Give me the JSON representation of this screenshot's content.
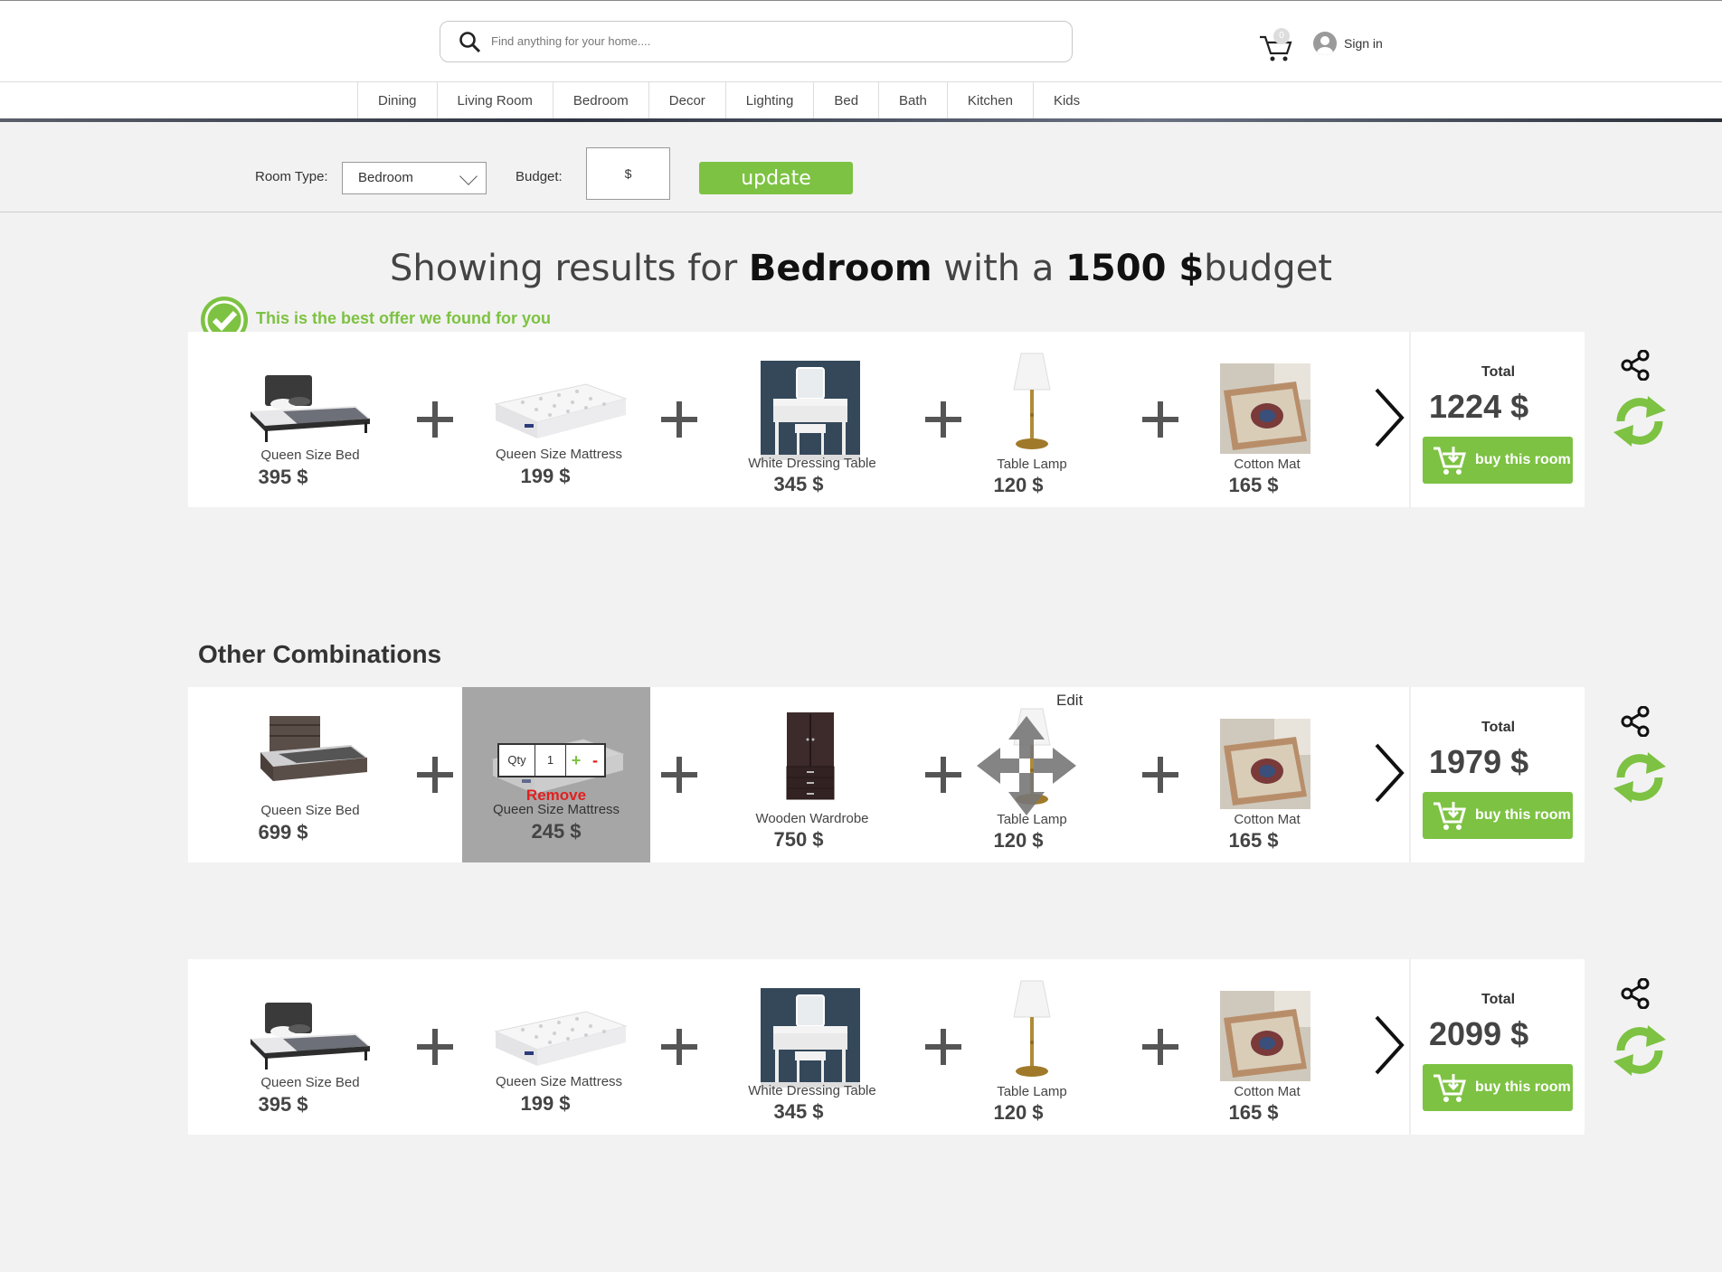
{
  "header": {
    "search_placeholder": "Find anything for your home....",
    "cart_count": "0",
    "signin_label": "Sign in"
  },
  "nav": {
    "items": [
      "Dining",
      "Living Room",
      "Bedroom",
      "Decor",
      "Lighting",
      "Bed",
      "Bath",
      "Kitchen",
      "Kids"
    ]
  },
  "filter": {
    "room_type_label": "Room Type:",
    "room_type_value": "Bedroom",
    "budget_label": "Budget:",
    "budget_value": "$",
    "update_label": "update"
  },
  "headline": {
    "prefix": "Showing results for ",
    "room": "Bedroom",
    "middle": " with a ",
    "budget": "1500 $",
    "suffix": "budget"
  },
  "best_offer_text": "This is the best offer we found for you",
  "other_title": "Other Combinations",
  "total_label": "Total",
  "buy_label": "buy this room",
  "colors": {
    "accent": "#7dc242",
    "remove": "#e02020"
  },
  "combos": [
    {
      "items": [
        {
          "name": "Queen Size Bed",
          "price": "395 $"
        },
        {
          "name": "Queen Size Mattress",
          "price": "199 $"
        },
        {
          "name": "White Dressing  Table",
          "price": "345 $"
        },
        {
          "name": "Table Lamp",
          "price": "120 $"
        },
        {
          "name": "Cotton Mat",
          "price": "165 $"
        }
      ],
      "total": "1224 $"
    },
    {
      "items": [
        {
          "name": "Queen Size Bed",
          "price": "699 $"
        },
        {
          "name": "Queen Size Mattress",
          "price": "245 $"
        },
        {
          "name": "Wooden Wardrobe",
          "price": "750 $"
        },
        {
          "name": "Table Lamp",
          "price": "120 $"
        },
        {
          "name": "Cotton Mat",
          "price": "165 $"
        }
      ],
      "total": "1979 $",
      "qty_label": "Qty",
      "qty_value": "1",
      "qty_plus": "+",
      "qty_minus": "-",
      "remove_label": "Remove",
      "edit_label": "Edit"
    },
    {
      "items": [
        {
          "name": "Queen Size Bed",
          "price": "395 $"
        },
        {
          "name": "Queen Size Mattress",
          "price": "199 $"
        },
        {
          "name": "White Dressing  Table",
          "price": "345 $"
        },
        {
          "name": "Table Lamp",
          "price": "120 $"
        },
        {
          "name": "Cotton Mat",
          "price": "165 $"
        }
      ],
      "total": "2099 $"
    }
  ]
}
